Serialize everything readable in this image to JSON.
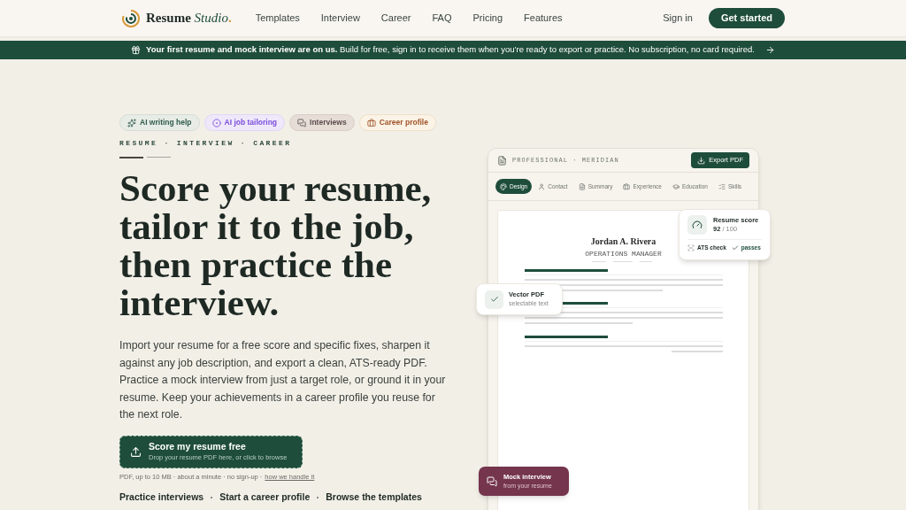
{
  "nav": {
    "logo": "Resume",
    "logo_accent": "Studio",
    "logo_dot": ".",
    "links": [
      "Templates",
      "Interview",
      "Career",
      "FAQ",
      "Pricing",
      "Features"
    ],
    "sign_in": "Sign in",
    "cta": "Get started"
  },
  "banner": {
    "bold": "Your first resume and mock interview are on us.",
    "text": "Build for free, sign in to receive them when you’re ready to export or practice. No subscription, no card required."
  },
  "chips": [
    {
      "label": "AI writing help",
      "kind": "sparkle",
      "color": "#2f5d4c"
    },
    {
      "label": "AI job tailoring",
      "kind": "target",
      "color": "#7c4ddb"
    },
    {
      "label": "Interviews",
      "kind": "chat",
      "color": "#5a4a4a"
    },
    {
      "label": "Career profile",
      "kind": "briefcase",
      "color": "#a0542a"
    }
  ],
  "eyebrow": "RESUME · INTERVIEW · CAREER",
  "headline": "Score your resume, tailor it to the job, then practice the interview.",
  "body": "Import your resume for a free score and specific fixes, sharpen it against any job description, and export a clean, ATS-ready PDF. Practice a mock interview from just a target role, or ground it in your resume. Keep your achievements in a career profile you reuse for the next role.",
  "upload": {
    "title": "Score my resume free",
    "subtitle": "Drop your resume PDF here, or click to browse"
  },
  "note": {
    "text": "PDF, up to 10 MB · about a minute · no sign-up ·",
    "link": "how we handle it"
  },
  "bottom_links": [
    "Practice interviews",
    "Start a career profile",
    "Browse the templates"
  ],
  "mockup": {
    "title": "PROFESSIONAL · MERIDIAN",
    "export": "Export PDF",
    "tabs": [
      {
        "label": "Design",
        "selected": true
      },
      {
        "label": "Contact",
        "selected": false
      },
      {
        "label": "Summary",
        "selected": false
      },
      {
        "label": "Experience",
        "selected": false
      },
      {
        "label": "Education",
        "selected": false
      },
      {
        "label": "Skills",
        "selected": false
      }
    ],
    "resume": {
      "name": "Jordan A. Rivera",
      "role": "OPERATIONS MANAGER"
    },
    "score": {
      "title": "Resume score",
      "value": "92",
      "total": "/ 100",
      "check": "ATS check",
      "status": "passes"
    },
    "vector": {
      "title": "Vector PDF",
      "subtitle": "selectable text"
    },
    "mock": {
      "title": "Mock interview",
      "subtitle": "from your resume"
    }
  }
}
